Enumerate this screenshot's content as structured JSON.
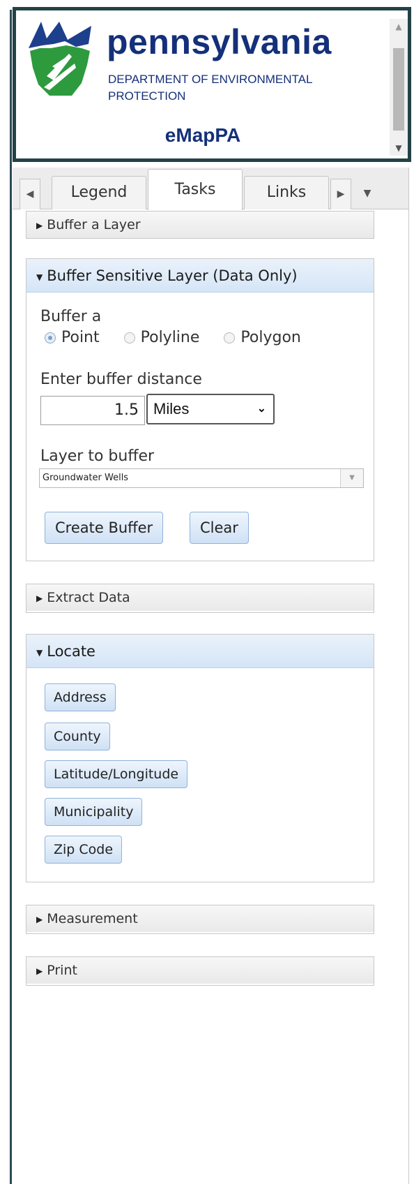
{
  "header": {
    "brand_name": "pennsylvania",
    "department": "DEPARTMENT OF ENVIRONMENTAL PROTECTION",
    "app_title": "eMapPA"
  },
  "tabs": {
    "items": [
      "Legend",
      "Tasks",
      "Links"
    ],
    "active": "Tasks"
  },
  "panels": {
    "buffer_layer": {
      "title": "Buffer a Layer",
      "expanded": false
    },
    "buffer_sensitive": {
      "title": "Buffer Sensitive Layer (Data Only)",
      "expanded": true,
      "buffer_a_label": "Buffer a",
      "geometry_options": [
        "Point",
        "Polyline",
        "Polygon"
      ],
      "geometry_selected": "Point",
      "distance_label": "Enter buffer distance",
      "distance_value": "1.5",
      "unit_value": "Miles",
      "layer_label": "Layer to buffer",
      "layer_value": "Groundwater Wells",
      "create_button": "Create Buffer",
      "clear_button": "Clear"
    },
    "extract_data": {
      "title": "Extract Data",
      "expanded": false
    },
    "locate": {
      "title": "Locate",
      "expanded": true,
      "buttons": [
        "Address",
        "County",
        "Latitude/Longitude",
        "Municipality",
        "Zip Code"
      ]
    },
    "measurement": {
      "title": "Measurement",
      "expanded": false
    },
    "print": {
      "title": "Print",
      "expanded": false
    }
  },
  "colors": {
    "brand_blue": "#14307a",
    "header_border": "#234246",
    "logo_green": "#2e9a3e",
    "logo_blue": "#1d3f8c"
  }
}
